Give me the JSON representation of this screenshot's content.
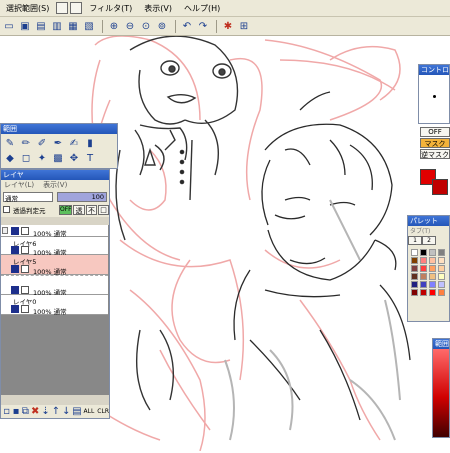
{
  "menubar": {
    "items": [
      "選択範囲(S)",
      "フィルタ(T)",
      "表示(V)",
      "ヘルプ(H)"
    ]
  },
  "toolbar": {
    "icons": [
      "new-icon",
      "open-icon",
      "save-icon",
      "cut-icon",
      "copy-icon",
      "paste-icon",
      "zoom-in-icon",
      "zoom-out-icon",
      "zoom-fit-icon",
      "zoom-reset-icon",
      "undo-icon",
      "redo-icon",
      "settings-icon",
      "crop-icon"
    ]
  },
  "tools_panel": {
    "title": "範囲"
  },
  "layer_panel": {
    "title": "レイヤ",
    "menu": [
      "レイヤ(L)",
      "表示(V)"
    ],
    "blend_mode": "通常",
    "opacity": "100",
    "protect_label": "透過判定元",
    "rows": [
      {
        "name": "",
        "info": "100% 通常",
        "selected": false
      },
      {
        "name": "レイヤ6",
        "info": "100% 通常",
        "selected": false
      },
      {
        "name": "レイヤ5",
        "info": "100% 通常",
        "selected": true
      },
      {
        "name": "",
        "info": "100% 通常",
        "selected": false
      },
      {
        "name": "レイヤ0",
        "info": "100% 通常",
        "selected": false
      }
    ],
    "footer_buttons": [
      "ALL",
      "CLR"
    ]
  },
  "control_panel": {
    "title": "コントロー",
    "buttons": [
      "OFF",
      "マスク",
      "逆マスク"
    ]
  },
  "palette_panel": {
    "title": "パレット",
    "tabs": [
      "1",
      "2"
    ],
    "colors": [
      "#ffffff",
      "#000000",
      "#c0c0c0",
      "#808080",
      "#7f3f00",
      "#ff8080",
      "#ffc0a0",
      "#ffe0c0",
      "#804040",
      "#ff4040",
      "#ffa060",
      "#ffd0a0",
      "#603020",
      "#c08060",
      "#f0c080",
      "#ffffc0",
      "#202080",
      "#4040c0",
      "#8080ff",
      "#c0c0ff",
      "#800000",
      "#c00000",
      "#ff0000",
      "#ff8040"
    ]
  },
  "colorpicker_panel": {
    "title": "範囲"
  }
}
